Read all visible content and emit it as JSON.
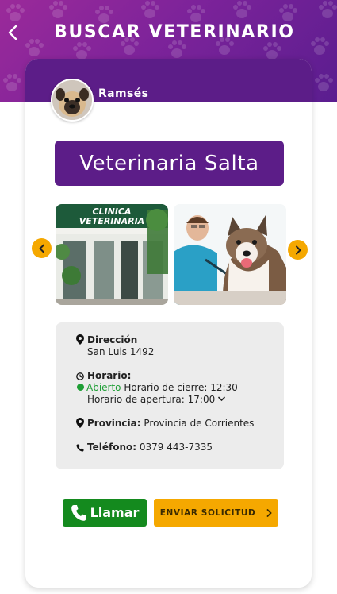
{
  "header": {
    "title": "BUSCAR VETERINARIO",
    "back_icon": "chevron-left-icon",
    "background_colors": [
      "#9b2a9a",
      "#5a1d8f"
    ]
  },
  "pet": {
    "name": "Ramsés",
    "avatar_icon": "pug-avatar"
  },
  "clinic": {
    "name": "Veterinaria Salta",
    "photo_1_sign": "CLINICA VETERINARIA",
    "photo_2_icon": "vet-with-husky-photo"
  },
  "info": {
    "address_label": "Dirección",
    "address_value": "San Luis 1492",
    "hours_label": "Horario:",
    "status": "Abierto",
    "closing": "Horario de cierre: 12:30",
    "opening": "Horario de apertura: 17:00",
    "province_label": "Provincia:",
    "province_value": "Provincia de Corrientes",
    "phone_label": "Teléfono:",
    "phone_value": "0379 443-7335"
  },
  "actions": {
    "call_label": "Llamar",
    "request_label": "ENVIAR SOLICITUD"
  },
  "colors": {
    "brand_purple": "#5c1d88",
    "accent_orange": "#f5a800",
    "call_green": "#148a1e",
    "open_green": "#1e9e35"
  }
}
